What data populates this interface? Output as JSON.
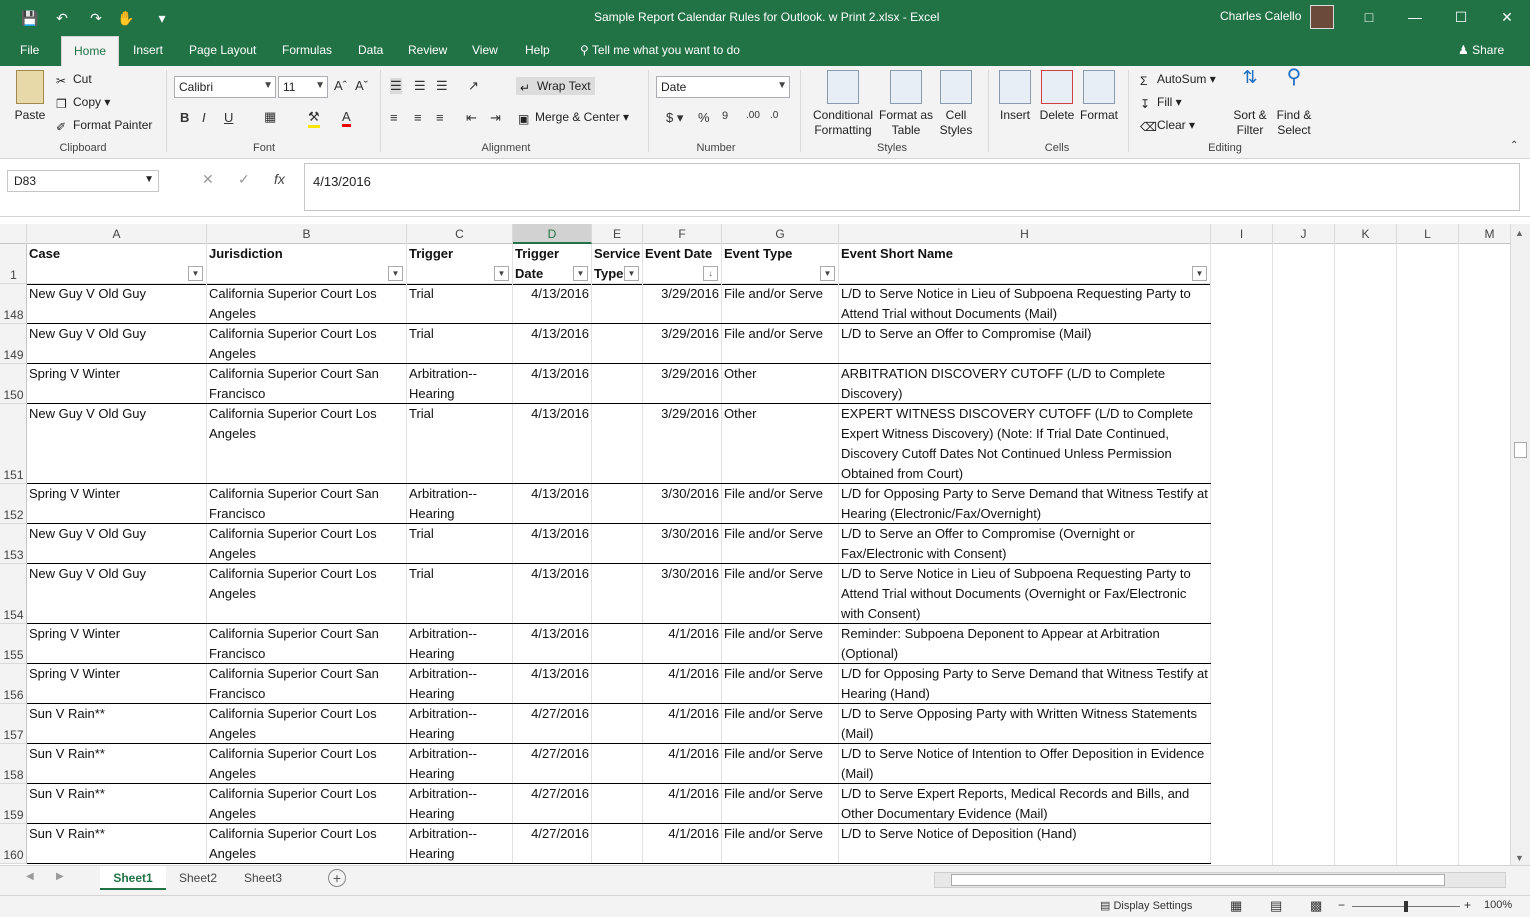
{
  "window": {
    "title": "Sample Report Calendar Rules for Outlook. w Print 2.xlsx  -  Excel",
    "user_name": "Charles Calello",
    "share_label": "Share",
    "tell_me": "Tell me what you want to do"
  },
  "tabs": [
    "File",
    "Home",
    "Insert",
    "Page Layout",
    "Formulas",
    "Data",
    "Review",
    "View",
    "Help"
  ],
  "ribbon": {
    "clipboard": {
      "paste": "Paste",
      "cut": "Cut",
      "copy": "Copy",
      "format_painter": "Format Painter",
      "label": "Clipboard"
    },
    "font": {
      "name": "Calibri",
      "size": "11",
      "label": "Font"
    },
    "alignment": {
      "wrap_text": "Wrap Text",
      "merge_center": "Merge & Center",
      "label": "Alignment"
    },
    "number": {
      "format": "Date",
      "label": "Number"
    },
    "styles": {
      "conditional": "Conditional",
      "formatting": "Formatting",
      "format_as": "Format as",
      "table": "Table",
      "cell": "Cell",
      "cell_styles": "Styles",
      "label": "Styles"
    },
    "cells": {
      "insert": "Insert",
      "delete": "Delete",
      "format": "Format",
      "label": "Cells"
    },
    "editing": {
      "autosum": "AutoSum",
      "fill": "Fill",
      "clear": "Clear",
      "sort": "Sort &",
      "filter": "Filter",
      "find": "Find &",
      "select": "Select",
      "label": "Editing"
    }
  },
  "formula_bar": {
    "name_box": "D83",
    "value": "4/13/2016"
  },
  "columns": [
    "A",
    "B",
    "C",
    "D",
    "E",
    "F",
    "G",
    "H",
    "I",
    "J",
    "K",
    "L",
    "M"
  ],
  "header_row": {
    "num": "1",
    "cells": [
      "Case",
      "Jurisdiction",
      "Trigger",
      "Trigger Date",
      "Service Type",
      "Event Date",
      "Event Type",
      "Event Short Name"
    ]
  },
  "rows": [
    {
      "num": "148",
      "case": "New Guy V Old Guy",
      "jur": "California Superior Court Los Angeles",
      "trig": "Trial",
      "tdate": "4/13/2016",
      "stype": "",
      "edate": "3/29/2016",
      "etype": "File and/or Serve",
      "name": "L/D to Serve Notice in Lieu of Subpoena Requesting Party to Attend Trial without Documents (Mail)"
    },
    {
      "num": "149",
      "case": "New Guy V Old Guy",
      "jur": "California Superior Court Los Angeles",
      "trig": "Trial",
      "tdate": "4/13/2016",
      "stype": "",
      "edate": "3/29/2016",
      "etype": "File and/or Serve",
      "name": "L/D to Serve an Offer to Compromise (Mail)"
    },
    {
      "num": "150",
      "case": "Spring V Winter",
      "jur": "California Superior Court San Francisco",
      "trig": "Arbitration--Hearing",
      "tdate": "4/13/2016",
      "stype": "",
      "edate": "3/29/2016",
      "etype": "Other",
      "name": "ARBITRATION DISCOVERY CUTOFF (L/D to Complete Discovery)"
    },
    {
      "num": "151",
      "case": "New Guy V Old Guy",
      "jur": "California Superior Court Los Angeles",
      "trig": "Trial",
      "tdate": "4/13/2016",
      "stype": "",
      "edate": "3/29/2016",
      "etype": "Other",
      "name": "EXPERT WITNESS DISCOVERY CUTOFF (L/D to Complete Expert Witness Discovery) (Note: If Trial Date Continued, Discovery Cutoff Dates Not Continued Unless Permission Obtained from Court)"
    },
    {
      "num": "152",
      "case": "Spring V Winter",
      "jur": "California Superior Court San Francisco",
      "trig": "Arbitration--Hearing",
      "tdate": "4/13/2016",
      "stype": "",
      "edate": "3/30/2016",
      "etype": "File and/or Serve",
      "name": "L/D for Opposing Party to Serve Demand that Witness Testify at Hearing (Electronic/Fax/Overnight)"
    },
    {
      "num": "153",
      "case": "New Guy V Old Guy",
      "jur": "California Superior Court Los Angeles",
      "trig": "Trial",
      "tdate": "4/13/2016",
      "stype": "",
      "edate": "3/30/2016",
      "etype": "File and/or Serve",
      "name": "L/D to Serve an Offer to Compromise (Overnight or Fax/Electronic with Consent)"
    },
    {
      "num": "154",
      "case": "New Guy V Old Guy",
      "jur": "California Superior Court Los Angeles",
      "trig": "Trial",
      "tdate": "4/13/2016",
      "stype": "",
      "edate": "3/30/2016",
      "etype": "File and/or Serve",
      "name": "L/D to Serve Notice in Lieu of Subpoena Requesting Party to Attend Trial without Documents (Overnight or Fax/Electronic with Consent)"
    },
    {
      "num": "155",
      "case": "Spring V Winter",
      "jur": "California Superior Court San Francisco",
      "trig": "Arbitration--Hearing",
      "tdate": "4/13/2016",
      "stype": "",
      "edate": "4/1/2016",
      "etype": "File and/or Serve",
      "name": "Reminder: Subpoena Deponent to Appear at Arbitration (Optional)"
    },
    {
      "num": "156",
      "case": "Spring V Winter",
      "jur": "California Superior Court San Francisco",
      "trig": "Arbitration--Hearing",
      "tdate": "4/13/2016",
      "stype": "",
      "edate": "4/1/2016",
      "etype": "File and/or Serve",
      "name": "L/D for Opposing Party to Serve Demand that Witness Testify at Hearing (Hand)"
    },
    {
      "num": "157",
      "case": "Sun V Rain**",
      "jur": "California Superior Court Los Angeles",
      "trig": "Arbitration--Hearing",
      "tdate": "4/27/2016",
      "stype": "",
      "edate": "4/1/2016",
      "etype": "File and/or Serve",
      "name": "L/D to Serve Opposing Party with Written Witness Statements (Mail)"
    },
    {
      "num": "158",
      "case": "Sun V Rain**",
      "jur": "California Superior Court Los Angeles",
      "trig": "Arbitration--Hearing",
      "tdate": "4/27/2016",
      "stype": "",
      "edate": "4/1/2016",
      "etype": "File and/or Serve",
      "name": "L/D to Serve Notice of Intention to Offer Deposition in Evidence (Mail)"
    },
    {
      "num": "159",
      "case": "Sun V Rain**",
      "jur": "California Superior Court Los Angeles",
      "trig": "Arbitration--Hearing",
      "tdate": "4/27/2016",
      "stype": "",
      "edate": "4/1/2016",
      "etype": "File and/or Serve",
      "name": "L/D to Serve Expert Reports, Medical Records and Bills, and Other Documentary Evidence (Mail)"
    },
    {
      "num": "160",
      "case": "Sun V Rain**",
      "jur": "California Superior Court Los Angeles",
      "trig": "Arbitration--Hearing",
      "tdate": "4/27/2016",
      "stype": "",
      "edate": "4/1/2016",
      "etype": "File and/or Serve",
      "name": "L/D to Serve Notice of Deposition (Hand)"
    }
  ],
  "sheet_tabs": [
    "Sheet1",
    "Sheet2",
    "Sheet3"
  ],
  "status": {
    "display_settings": "Display Settings",
    "zoom": "100%"
  },
  "colors": {
    "accent": "#217346"
  }
}
